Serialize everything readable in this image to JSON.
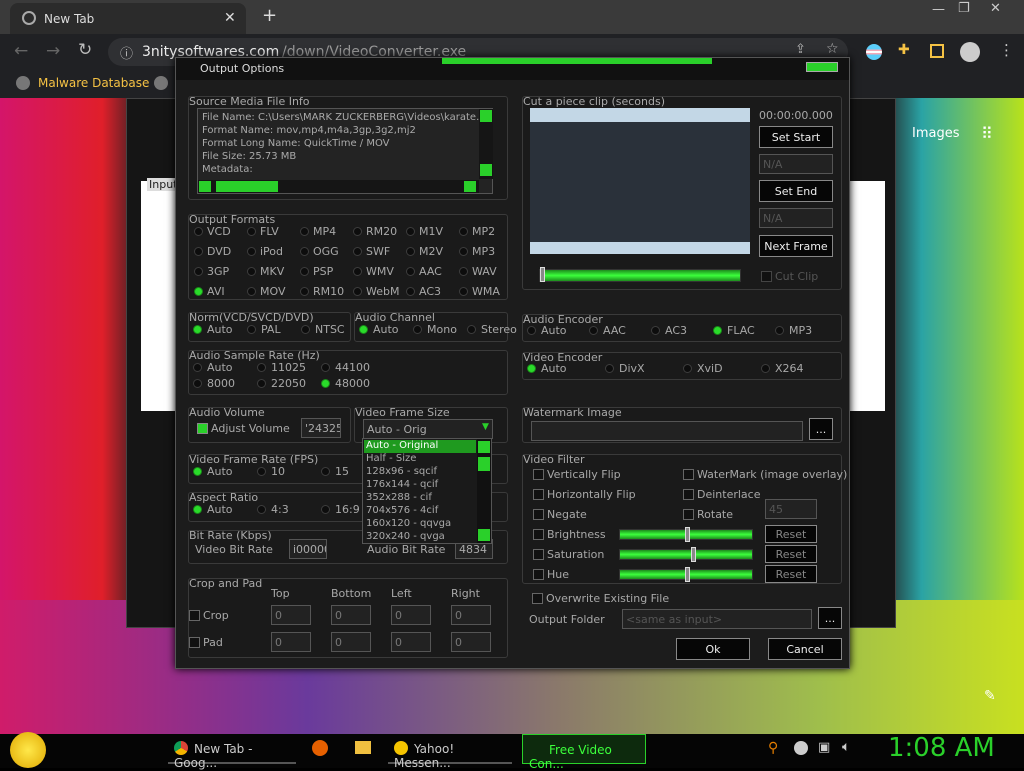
{
  "browser": {
    "tab_title": "New Tab",
    "url_host": "3nitysoftwares.com",
    "url_path": "/down/VideoConverter.exe",
    "bookmark": "Malware Database",
    "images_link": "Images"
  },
  "dialog": {
    "title": "Output Options",
    "source": {
      "group_label": "Source Media File Info",
      "lines": [
        "File Name: C:\\Users\\MARK ZUCKERBERG\\Videos\\karate.r",
        "Format Name: mov,mp4,m4a,3gp,3g2,mj2",
        "Format Long Name: QuickTime / MOV",
        "File Size: 25.73 MB",
        "Metadata:"
      ]
    },
    "output_formats": {
      "group_label": "Output Formats",
      "rows": [
        [
          "VCD",
          "FLV",
          "MP4",
          "RM20",
          "M1V",
          "MP2"
        ],
        [
          "DVD",
          "iPod",
          "OGG",
          "SWF",
          "M2V",
          "MP3"
        ],
        [
          "3GP",
          "MKV",
          "PSP",
          "WMV",
          "AAC",
          "WAV"
        ],
        [
          "AVI",
          "MOV",
          "RM10",
          "WebM",
          "AC3",
          "WMA"
        ]
      ],
      "selected": "AVI"
    },
    "norm": {
      "group_label": "Norm(VCD/SVCD/DVD)",
      "options": [
        "Auto",
        "PAL",
        "NTSC"
      ],
      "selected": "Auto"
    },
    "audio_channel": {
      "group_label": "Audio Channel",
      "options": [
        "Auto",
        "Mono",
        "Stereo"
      ],
      "selected": "Auto"
    },
    "audio_sample_rate": {
      "group_label": "Audio Sample Rate (Hz)",
      "options": [
        "Auto",
        "11025",
        "44100",
        "8000",
        "22050",
        "48000"
      ],
      "selected": "48000"
    },
    "audio_volume": {
      "group_label": "Audio Volume",
      "checkbox_label": "Adjust Volume",
      "value": "'24325"
    },
    "video_frame_size": {
      "group_label": "Video Frame Size",
      "value": "Auto - Orig",
      "options": [
        "Auto - Original",
        "Half - Size",
        "128x96 - sqcif",
        "176x144 - qcif",
        "352x288 - cif",
        "704x576 - 4cif",
        "160x120 - qqvga",
        "320x240 - qvga"
      ],
      "highlighted": "Auto - Original"
    },
    "video_frame_rate": {
      "group_label": "Video Frame Rate (FPS)",
      "options": [
        "Auto",
        "10",
        "15"
      ],
      "selected": "Auto"
    },
    "aspect_ratio": {
      "group_label": "Aspect Ratio",
      "options": [
        "Auto",
        "4:3",
        "16:9"
      ],
      "selected": "Auto"
    },
    "bit_rate": {
      "group_label": "Bit Rate (Kbps)",
      "video_label": "Video Bit Rate",
      "video_value": "i00000",
      "audio_label": "Audio Bit Rate",
      "audio_value": "4834"
    },
    "crop_pad": {
      "group_label": "Crop and Pad",
      "columns": [
        "Top",
        "Bottom",
        "Left",
        "Right"
      ],
      "crop_label": "Crop",
      "pad_label": "Pad",
      "crop_values": [
        "0",
        "0",
        "0",
        "0"
      ],
      "pad_values": [
        "0",
        "0",
        "0",
        "0"
      ]
    },
    "cut_clip": {
      "group_label": "Cut a piece clip (seconds)",
      "time": "00:00:00.000",
      "set_start": "Set Start",
      "start_value": "N/A",
      "set_end": "Set End",
      "end_value": "N/A",
      "next_frame": "Next Frame",
      "cut_clip_label": "Cut Clip"
    },
    "audio_encoder": {
      "group_label": "Audio Encoder",
      "options": [
        "Auto",
        "AAC",
        "AC3",
        "FLAC",
        "MP3"
      ],
      "selected": "FLAC"
    },
    "video_encoder": {
      "group_label": "Video Encoder",
      "options": [
        "Auto",
        "DivX",
        "XviD",
        "X264"
      ],
      "selected": "Auto"
    },
    "watermark": {
      "group_label": "Watermark Image",
      "browse": "..."
    },
    "video_filter": {
      "group_label": "Video Filter",
      "left": [
        "Vertically Flip",
        "Horizontally Flip",
        "Negate",
        "Brightness",
        "Saturation",
        "Hue"
      ],
      "right": [
        "WaterMark (image overlay)",
        "Deinterlace",
        "Rotate"
      ],
      "rotate_value": "45",
      "reset": "Reset",
      "brightness_level": 0.5,
      "saturation_level": 0.55,
      "hue_level": 0.5
    },
    "overwrite_label": "Overwrite Existing File",
    "output_folder_label": "Output Folder",
    "output_folder_placeholder": "<same as input>",
    "ok": "Ok",
    "cancel": "Cancel"
  },
  "taskbar": {
    "items": [
      "New Tab - Goog...",
      "Yahoo! Messen...",
      "Free Video Con..."
    ],
    "clock": "1:08 AM"
  }
}
